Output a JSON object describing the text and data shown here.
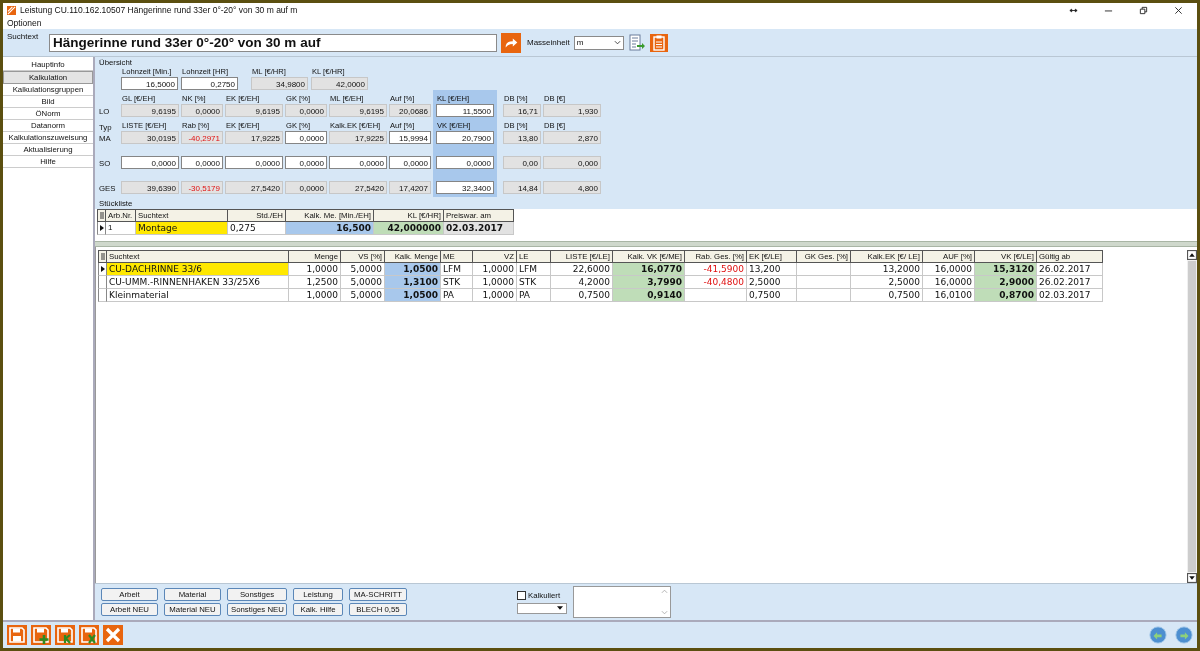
{
  "window": {
    "title": "Leistung CU.110.162.10507 Hängerinne rund 33er 0°-20° von 30 m auf m"
  },
  "menu": [
    {
      "label": "Optionen"
    }
  ],
  "search": {
    "label": "Suchtext",
    "value": "Hängerinne rund 33er 0°-20° von 30 m auf",
    "unit_label": "Masseinheit",
    "unit": "m"
  },
  "sidebar": {
    "items": [
      {
        "label": "Hauptinfo",
        "selected": false
      },
      {
        "label": "Kalkulation",
        "selected": true
      },
      {
        "label": "Kalkulationsgruppen",
        "selected": false
      },
      {
        "label": "Bild",
        "selected": false
      },
      {
        "label": "ÖNorm",
        "selected": false
      },
      {
        "label": "Datanorm",
        "selected": false
      },
      {
        "label": "Kalkulationszuweisung",
        "selected": false
      },
      {
        "label": "Aktualisierung",
        "selected": false
      },
      {
        "label": "Hilfe",
        "selected": false
      }
    ]
  },
  "overview": {
    "title": "Übersicht",
    "top": [
      {
        "label": "Lohnzeit [Min.]",
        "value": "16,5000",
        "kind": "input"
      },
      {
        "label": "Lohnzeit [HR]",
        "value": "0,2750",
        "kind": "input"
      },
      {
        "label": "ML [€/HR]",
        "value": "34,9800",
        "kind": "readonly"
      },
      {
        "label": "KL [€/HR]",
        "value": "42,0000",
        "kind": "readonly"
      }
    ],
    "rows": [
      {
        "label": "LO",
        "headers": [
          "GL [€/EH]",
          "NK [%]",
          "EK [€/EH]",
          "GK [%]",
          "ML [€/EH]",
          "Auf [%]",
          "KL [€/EH]",
          "DB [%]",
          "DB [€]"
        ],
        "cells": [
          {
            "value": "9,6195",
            "kind": "readonly"
          },
          {
            "value": "0,0000",
            "kind": "readonly"
          },
          {
            "value": "9,6195",
            "kind": "readonly"
          },
          {
            "value": "0,0000",
            "kind": "readonly"
          },
          {
            "value": "9,6195",
            "kind": "readonly"
          },
          {
            "value": "20,0686",
            "kind": "readonly"
          },
          {
            "value": "11,5500",
            "kind": "key"
          },
          {
            "value": "16,71",
            "kind": "readonly"
          },
          {
            "value": "1,930",
            "kind": "readonly"
          }
        ]
      },
      {
        "label": "MA",
        "prefix": "Typ",
        "headers": [
          "LISTE [€/EH]",
          "Rab [%]",
          "EK [€/EH]",
          "GK [%]",
          "Kalk.EK [€/EH]",
          "Auf [%]",
          "VK [€/EH]",
          "DB [%]",
          "DB [€]"
        ],
        "cells": [
          {
            "value": "30,0195",
            "kind": "readonly"
          },
          {
            "value": "-40,2971",
            "kind": "negative"
          },
          {
            "value": "17,9225",
            "kind": "readonly"
          },
          {
            "value": "0,0000",
            "kind": "input"
          },
          {
            "value": "17,9225",
            "kind": "readonly"
          },
          {
            "value": "15,9994",
            "kind": "input"
          },
          {
            "value": "20,7900",
            "kind": "key"
          },
          {
            "value": "13,80",
            "kind": "readonly"
          },
          {
            "value": "2,870",
            "kind": "readonly"
          }
        ]
      },
      {
        "label": "SO",
        "cells": [
          {
            "value": "0,0000",
            "kind": "input"
          },
          {
            "value": "0,0000",
            "kind": "input"
          },
          {
            "value": "0,0000",
            "kind": "input"
          },
          {
            "value": "0,0000",
            "kind": "input"
          },
          {
            "value": "0,0000",
            "kind": "input"
          },
          {
            "value": "0,0000",
            "kind": "input"
          },
          {
            "value": "0,0000",
            "kind": "key"
          },
          {
            "value": "0,00",
            "kind": "readonly"
          },
          {
            "value": "0,000",
            "kind": "readonly"
          }
        ]
      },
      {
        "label": "GES",
        "cells": [
          {
            "value": "39,6390",
            "kind": "readonly"
          },
          {
            "value": "-30,5179",
            "kind": "negative"
          },
          {
            "value": "27,5420",
            "kind": "readonly"
          },
          {
            "value": "0,0000",
            "kind": "readonly"
          },
          {
            "value": "27,5420",
            "kind": "readonly"
          },
          {
            "value": "17,4207",
            "kind": "readonly"
          },
          {
            "value": "32,3400",
            "kind": "key"
          },
          {
            "value": "14,84",
            "kind": "readonly"
          },
          {
            "value": "4,800",
            "kind": "readonly"
          }
        ]
      }
    ]
  },
  "parts_list": {
    "title": "Stückliste",
    "columns": [
      {
        "label": "Arb.Nr.",
        "kind": "text"
      },
      {
        "label": "Suchtext",
        "kind": "name"
      },
      {
        "label": "Std./EH",
        "kind": "input"
      },
      {
        "label": "Kalk. Me. [Min./EH]",
        "kind": "calc"
      },
      {
        "label": "KL [€/HR]",
        "kind": "price"
      },
      {
        "label": "Preiswar. am",
        "kind": "readonly"
      }
    ],
    "rows": [
      {
        "selected": true,
        "cells": [
          "1",
          "Montage",
          "0,275",
          "16,500",
          "42,000000",
          "02.03.2017"
        ]
      }
    ]
  },
  "main_table": {
    "columns": [
      {
        "label": "Suchtext",
        "kind": "name"
      },
      {
        "label": "Menge",
        "kind": "number"
      },
      {
        "label": "VS [%]",
        "kind": "number"
      },
      {
        "label": "Kalk. Menge",
        "kind": "calc"
      },
      {
        "label": "ME",
        "kind": "text"
      },
      {
        "label": "VZ",
        "kind": "number"
      },
      {
        "label": "LE",
        "kind": "text"
      },
      {
        "label": "LISTE [€/LE]",
        "kind": "number"
      },
      {
        "label": "Kalk. VK [€/ME]",
        "kind": "price"
      },
      {
        "label": "Rab. Ges. [%]",
        "kind": "discount"
      },
      {
        "label": "EK [€/LE]",
        "kind": "text"
      },
      {
        "label": "GK Ges. [%]",
        "kind": "number"
      },
      {
        "label": "Kalk.EK [€/ LE]",
        "kind": "number"
      },
      {
        "label": "AUF [%]",
        "kind": "number"
      },
      {
        "label": "VK [€/LE]",
        "kind": "price"
      },
      {
        "label": "Gültig ab",
        "kind": "text"
      }
    ],
    "rows": [
      {
        "selected": true,
        "cells": [
          "CU-DACHRINNE 33/6",
          "1,0000",
          "5,0000",
          "1,0500",
          "LFM",
          "1,0000",
          "LFM",
          "22,6000",
          "16,0770",
          "-41,5900",
          "13,200",
          null,
          "13,2000",
          "16,0000",
          "15,3120",
          "26.02.2017"
        ]
      },
      {
        "selected": false,
        "cells": [
          "CU-UMM.-RINNENHAKEN 33/25X6",
          "1,2500",
          "5,0000",
          "1,3100",
          "STK",
          "1,0000",
          "STK",
          "4,2000",
          "3,7990",
          "-40,4800",
          "2,5000",
          null,
          "2,5000",
          "16,0000",
          "2,9000",
          "26.02.2017"
        ]
      },
      {
        "selected": false,
        "cells": [
          "Kleinmaterial",
          "1,0000",
          "5,0000",
          "1,0500",
          "PA",
          "1,0000",
          "PA",
          "0,7500",
          "0,9140",
          null,
          "0,7500",
          null,
          "0,7500",
          "16,0100",
          "0,8700",
          "02.03.2017"
        ]
      }
    ]
  },
  "buttons": [
    [
      "Arbeit",
      "Arbeit NEU"
    ],
    [
      "Material",
      "Material NEU"
    ],
    [
      "Sonstiges",
      "Sonstiges NEU"
    ],
    [
      "Leistung",
      "Kalk. Hilfe"
    ],
    [
      "MA-SCHRITT",
      "BLECH 0,55"
    ]
  ],
  "calculated": {
    "label": "Kalkuliert",
    "checked": false
  }
}
